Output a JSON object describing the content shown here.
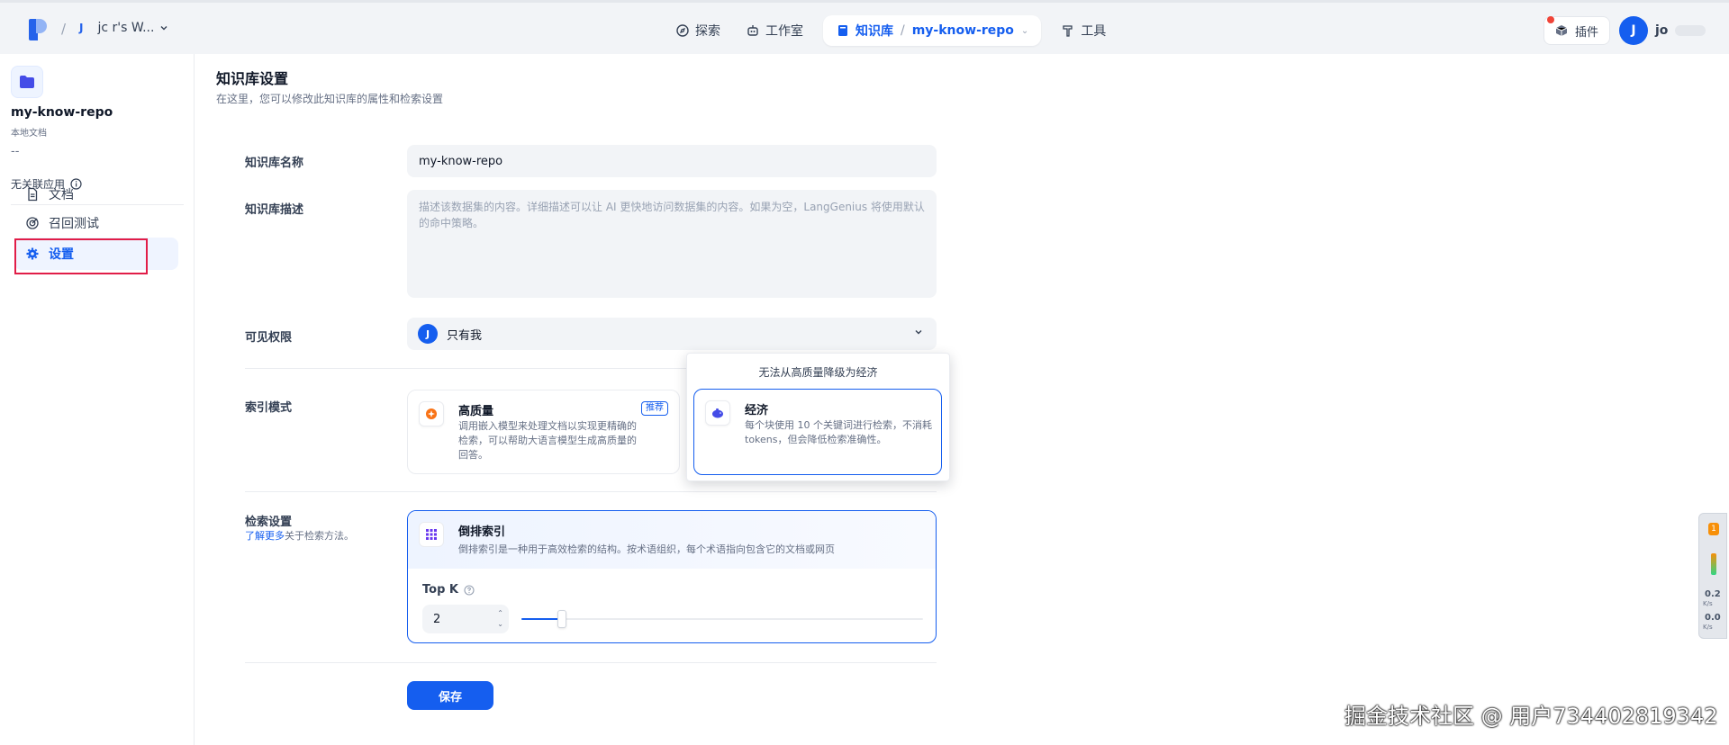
{
  "topbar": {
    "workspace_initial": "J",
    "workspace_name": "jc  r's W...",
    "nav": {
      "explore": "探索",
      "studio": "工作室",
      "knowledge": "知识库",
      "repo": "my-know-repo",
      "tools": "工具"
    },
    "plugins_label": "插件",
    "user_initial": "J",
    "user_name": "jo"
  },
  "sidebar": {
    "repo_name": "my-know-repo",
    "repo_type": "本地文档",
    "repo_desc": "--",
    "no_app": "无关联应用",
    "items": [
      {
        "label": "文档"
      },
      {
        "label": "召回测试"
      },
      {
        "label": "设置"
      }
    ]
  },
  "page": {
    "title": "知识库设置",
    "subtitle": "在这里，您可以修改此知识库的属性和检索设置"
  },
  "form": {
    "name_label": "知识库名称",
    "name_value": "my-know-repo",
    "desc_label": "知识库描述",
    "desc_placeholder": "描述该数据集的内容。详细描述可以让 AI 更快地访问数据集的内容。如果为空，LangGenius 将使用默认的命中策略。",
    "perm_label": "可见权限",
    "perm_avatar": "J",
    "perm_value": "只有我",
    "index_label": "索引模式",
    "high_quality_title": "高质量",
    "high_quality_badge": "推荐",
    "high_quality_desc": "调用嵌入模型来处理文档以实现更精确的检索，可以帮助大语言模型生成高质量的回答。",
    "econ_tooltip": "无法从高质量降级为经济",
    "econ_title": "经济",
    "econ_desc": "每个块使用 10 个关键词进行检索，不消耗 tokens，但会降低检索准确性。",
    "retrieval_label": "检索设置",
    "retrieval_link": "了解更多",
    "retrieval_sub": "关于检索方法。",
    "inverted_title": "倒排索引",
    "inverted_desc": "倒排索引是一种用于高效检索的结构。按术语组织，每个术语指向包含它的文档或网页",
    "topk_label": "Top K",
    "topk_value": "2",
    "topk_fraction": 0.1,
    "save_label": "保存"
  },
  "widget": {
    "badge": "1",
    "up_value": "0.2",
    "up_unit": "K/s",
    "down_value": "0.0",
    "down_unit": "K/s"
  },
  "watermark": "掘金技术社区 @ 用户734402819342",
  "colors": {
    "accent": "#155eef",
    "highlight_frame": "#e11d48"
  }
}
